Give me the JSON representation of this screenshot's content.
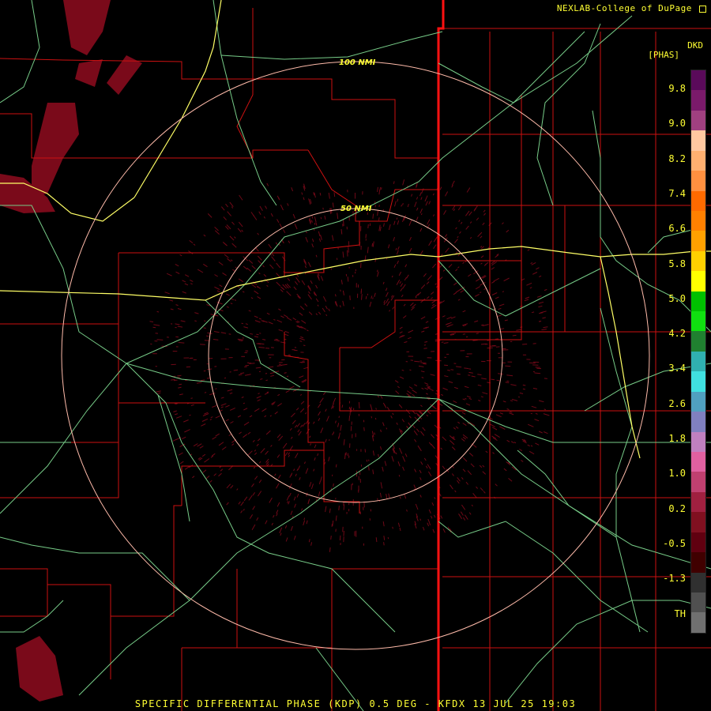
{
  "credit": "NEXLAB-College of DuPage",
  "product": {
    "code": "DKD",
    "unit": "[PHAS]",
    "caption": "SPECIFIC DIFFERENTIAL PHASE (KDP) 0.5 DEG - KFDX 13 JUL 25 19:03"
  },
  "range_rings": [
    {
      "label": "50 NMI"
    },
    {
      "label": "100 NMI"
    }
  ],
  "legend": {
    "ticks": [
      "9.8",
      "9.0",
      "8.2",
      "7.4",
      "6.6",
      "5.8",
      "5.0",
      "4.2",
      "3.4",
      "2.6",
      "1.8",
      "1.0",
      "0.2",
      "-0.5",
      "-1.3",
      "TH"
    ],
    "colors": [
      "#5a0a5a",
      "#7a1a6a",
      "#a04080",
      "#ffc8a0",
      "#ffb070",
      "#ff9040",
      "#ff6a00",
      "#ff8000",
      "#ffa000",
      "#ffd000",
      "#ffff00",
      "#00c000",
      "#10e010",
      "#208030",
      "#30b0b0",
      "#40e0e0",
      "#50a0c0",
      "#8080c0",
      "#c080c0",
      "#e060a0",
      "#c04070",
      "#a02040",
      "#801020",
      "#600010",
      "#400000",
      "#303030",
      "#505050",
      "#707070"
    ]
  },
  "colors": {
    "county_lines": "#cc1111",
    "state_line": "#ff1111",
    "roads": "#77cc88",
    "highway": "#ffff66",
    "range_ring": "#ffbbaa",
    "echo": "#7a0a1a"
  }
}
